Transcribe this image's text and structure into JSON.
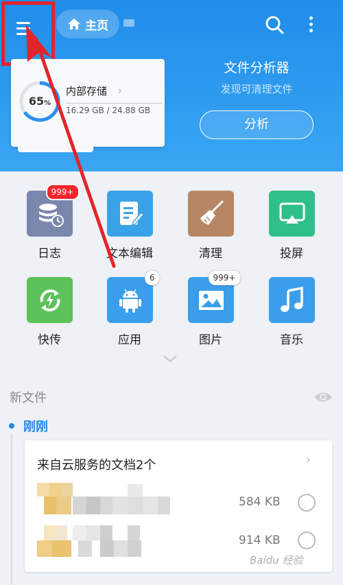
{
  "header": {
    "home_label": "主页",
    "storage": {
      "percent": "65",
      "percent_sign": "%",
      "title": "内部存储",
      "size": "16.29 GB / 24.88 GB",
      "used_fraction": 0.65
    },
    "analyzer": {
      "title": "文件分析器",
      "subtitle": "发现可清理文件",
      "button": "分析"
    }
  },
  "shortcuts": [
    {
      "label": "日志",
      "badge": "999+",
      "icon": "log-icon",
      "color": "#7b86ad"
    },
    {
      "label": "文本编辑",
      "badge": "",
      "icon": "text-edit-icon",
      "color": "#3aa3e8"
    },
    {
      "label": "清理",
      "badge": "",
      "icon": "broom-icon",
      "color": "#b78765"
    },
    {
      "label": "投屏",
      "badge": "",
      "icon": "cast-icon",
      "color": "#2fbf88"
    },
    {
      "label": "快传",
      "badge": "",
      "icon": "transfer-icon",
      "color": "#5cc25a"
    },
    {
      "label": "应用",
      "badge": "6",
      "icon": "android-icon",
      "color": "#3a9eea"
    },
    {
      "label": "图片",
      "badge": "999+",
      "icon": "image-icon",
      "color": "#3a9eea"
    },
    {
      "label": "音乐",
      "badge": "",
      "icon": "music-icon",
      "color": "#3a9eea"
    }
  ],
  "new_files": {
    "title": "新文件",
    "group_label": "刚刚",
    "card_title": "来自云服务的文档2个",
    "rows": [
      {
        "size": "584 KB"
      },
      {
        "size": "914 KB"
      }
    ]
  },
  "watermark": "Baidu 经验"
}
